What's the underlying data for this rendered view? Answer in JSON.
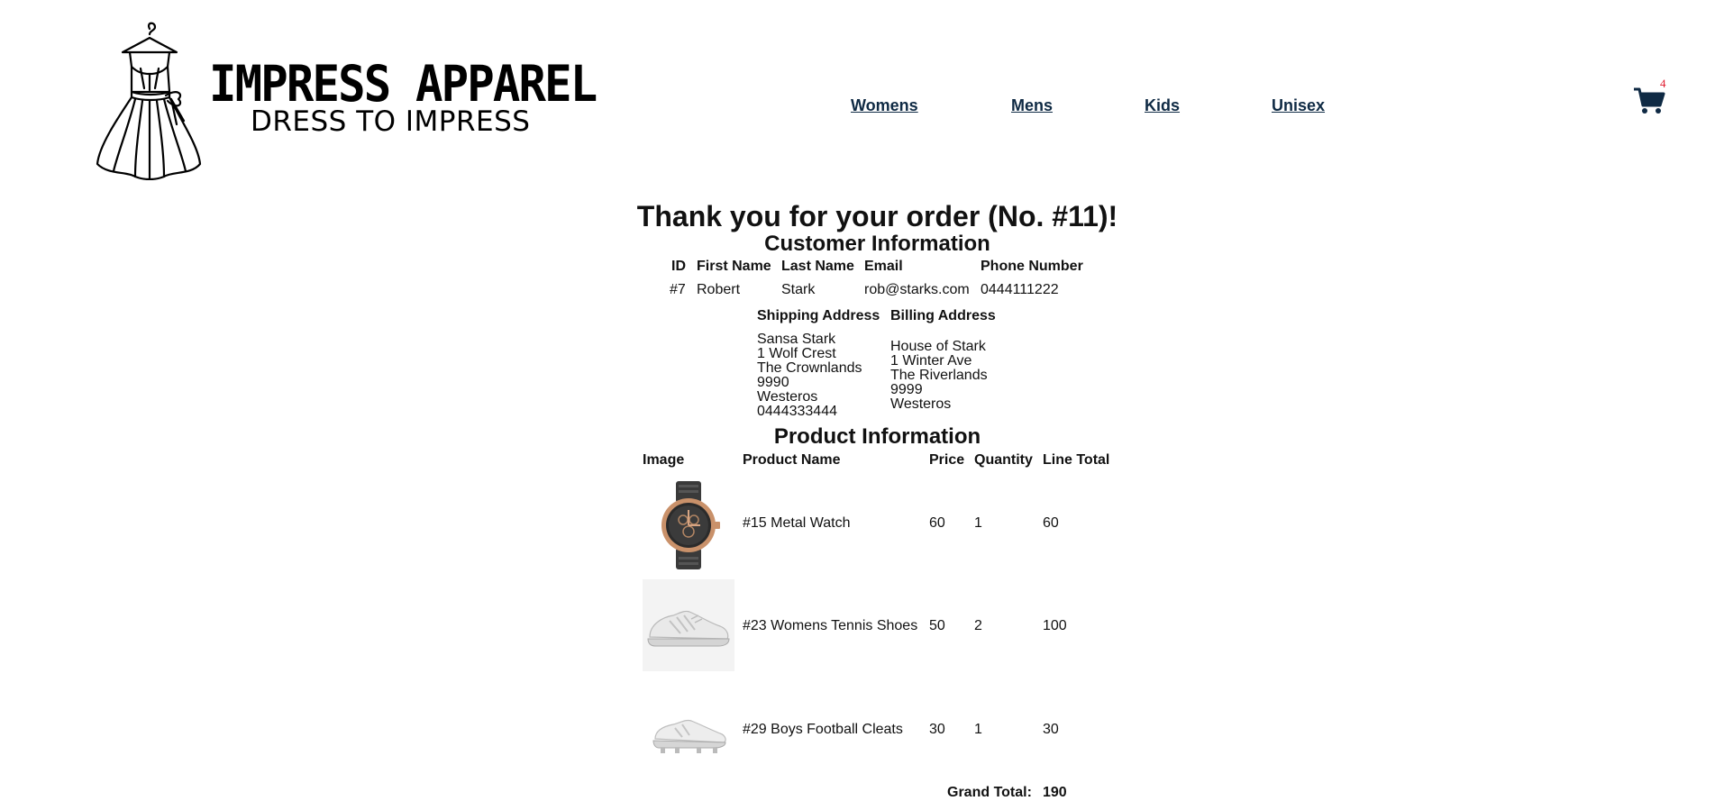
{
  "brand": {
    "name": "IMPRESS APPAREL",
    "tagline": "DRESS TO IMPRESS"
  },
  "nav": {
    "items": [
      "Womens",
      "Mens",
      "Kids",
      "Unisex"
    ]
  },
  "cart": {
    "count": "4"
  },
  "order": {
    "heading": "Thank you for your order (No. #11)!"
  },
  "customer": {
    "heading": "Customer Information",
    "headers": [
      "ID",
      "First Name",
      "Last Name",
      "Email",
      "Phone Number"
    ],
    "row": [
      "#7",
      "Robert",
      "Stark",
      "rob@starks.com",
      "0444111222"
    ],
    "shipping_label": "Shipping Address",
    "billing_label": "Billing Address",
    "shipping_lines": [
      "Sansa Stark",
      "1 Wolf Crest",
      "The Crownlands",
      "9990",
      "Westeros",
      "0444333444"
    ],
    "billing_lines": [
      "House of Stark",
      "1 Winter Ave",
      "The Riverlands",
      "9999",
      "Westeros"
    ]
  },
  "products": {
    "heading": "Product Information",
    "headers": [
      "Image",
      "Product Name",
      "Price",
      "Quantity",
      "Line Total"
    ],
    "rows": [
      {
        "name": "#15 Metal Watch",
        "price": "60",
        "qty": "1",
        "total": "60",
        "image": "watch-image"
      },
      {
        "name": "#23 Womens Tennis Shoes",
        "price": "50",
        "qty": "2",
        "total": "100",
        "image": "tennis-shoe-image"
      },
      {
        "name": "#29 Boys Football Cleats",
        "price": "30",
        "qty": "1",
        "total": "30",
        "image": "football-cleat-image"
      }
    ],
    "grand_total_label": "Grand Total:",
    "grand_total_value": "190"
  },
  "colors": {
    "nav_link": "#0f2a44",
    "cart_icon": "#0f2a44",
    "cart_badge": "#e0192c"
  }
}
